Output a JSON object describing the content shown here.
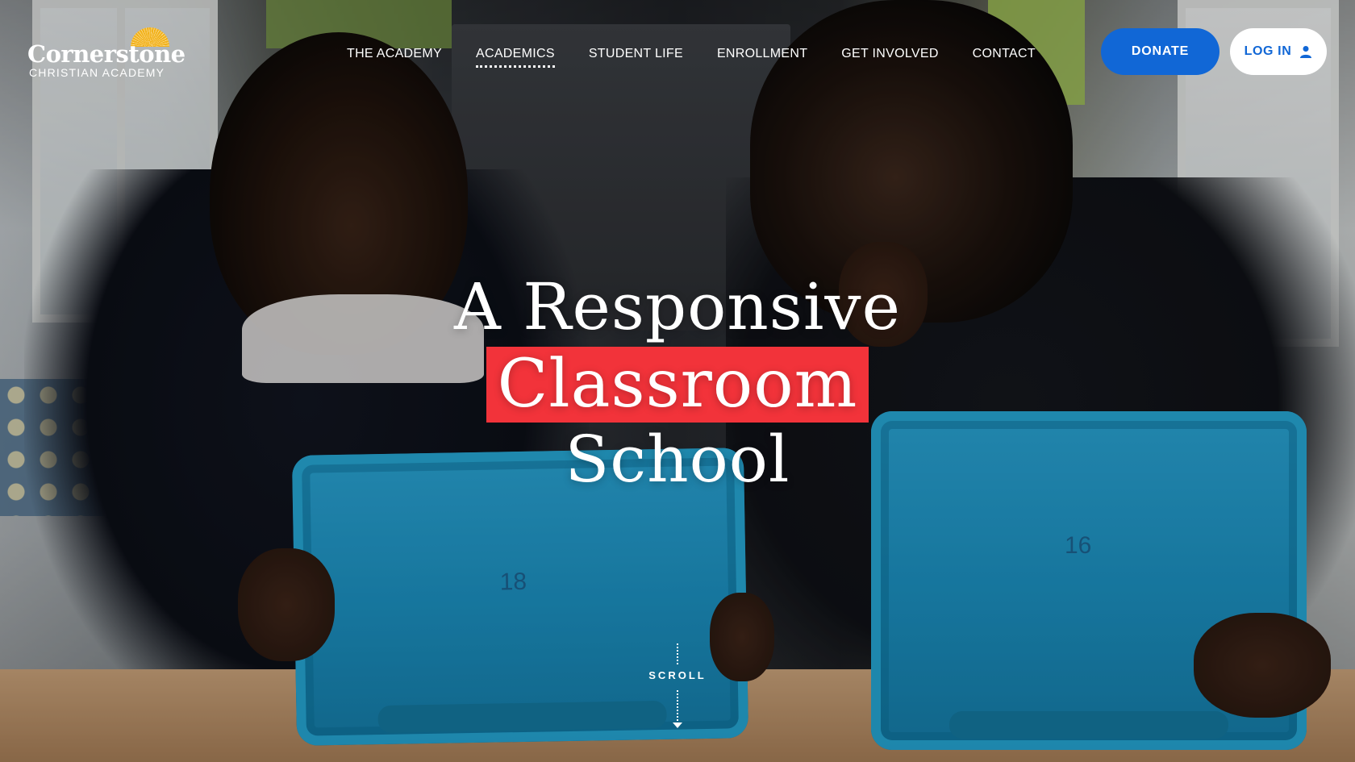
{
  "logo": {
    "name": "Cornerstone",
    "subtitle": "CHRISTIAN ACADEMY"
  },
  "nav": {
    "items": [
      {
        "label": "THE ACADEMY",
        "active": false
      },
      {
        "label": "ACADEMICS",
        "active": true
      },
      {
        "label": "STUDENT LIFE",
        "active": false
      },
      {
        "label": "ENROLLMENT",
        "active": false
      },
      {
        "label": "GET INVOLVED",
        "active": false
      },
      {
        "label": "CONTACT",
        "active": false
      }
    ]
  },
  "actions": {
    "donate_label": "DONATE",
    "login_label": "LOG IN",
    "login_icon": "user-icon"
  },
  "hero": {
    "line1": "A Responsive",
    "line2": "Classroom",
    "line3": "School",
    "scroll_label": "SCROLL",
    "tablet_left_number": "18",
    "tablet_right_number": "16"
  },
  "colors": {
    "donate": "#1167d6",
    "highlight": "#f2333a",
    "logo_sun": "#f2b21b",
    "tablet": "#1b8fbf"
  }
}
